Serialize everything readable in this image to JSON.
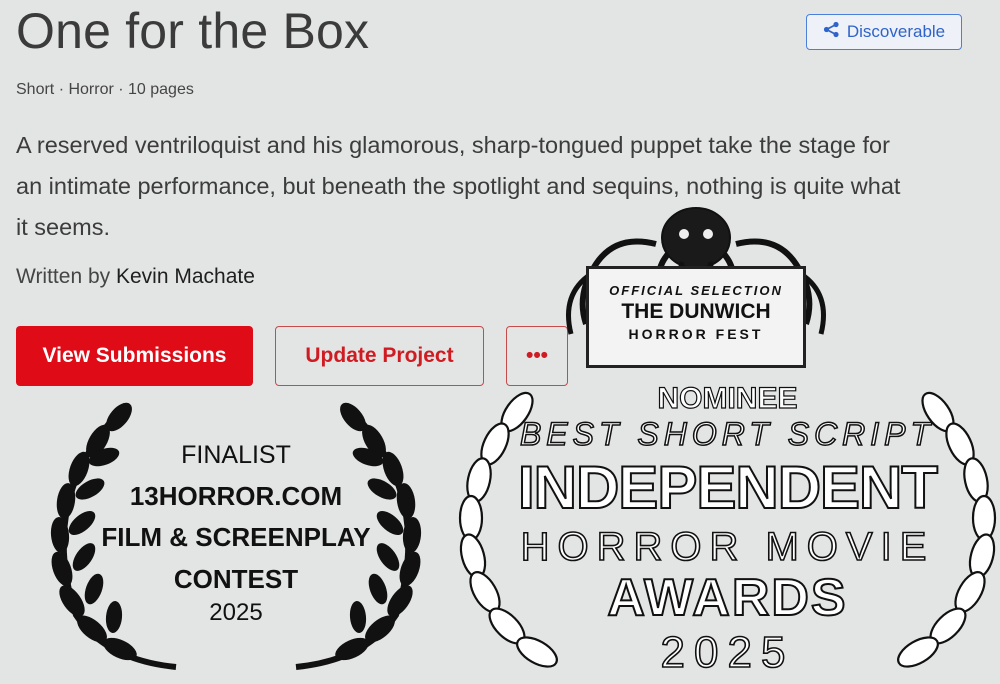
{
  "project": {
    "title": "One for the Box",
    "meta": "Short · Horror · 10 pages",
    "description": "A reserved ventriloquist and his glamorous, sharp-tongued puppet take the stage for an intimate performance, but beneath the spotlight and sequins, nothing is quite what it seems.",
    "written_by_label": "Written by",
    "author": "Kevin Machate"
  },
  "header": {
    "discoverable_label": "Discoverable",
    "icon": "share-icon"
  },
  "actions": {
    "view_submissions": "View Submissions",
    "update_project": "Update Project",
    "more": "•••"
  },
  "laurels": {
    "finalist": {
      "status": "FINALIST",
      "line1": "13HORROR.COM",
      "line2": "FILM & SCREENPLAY",
      "line3": "CONTEST",
      "year": "2025"
    },
    "dunwich": {
      "selection": "OFFICIAL SELECTION",
      "name": "THE DUNWICH",
      "fest": "HORROR FEST"
    },
    "ihma": {
      "status": "NOMINEE",
      "category": "BEST SHORT SCRIPT",
      "line1": "INDEPENDENT",
      "line2": "HORROR MOVIE",
      "line3": "AWARDS",
      "year": "2025"
    }
  },
  "colors": {
    "primary_red": "#df0c17",
    "link_blue": "#2f63c9",
    "background": "#e3e4e4"
  }
}
